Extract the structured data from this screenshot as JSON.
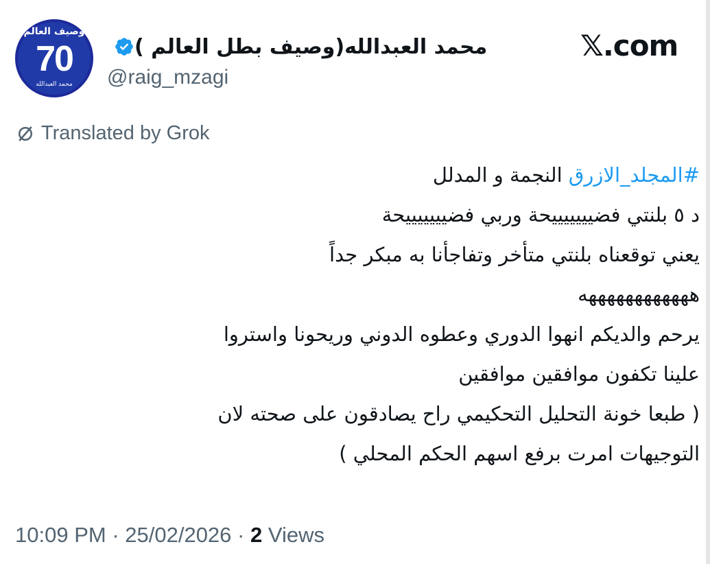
{
  "header": {
    "brand": "𝕏.com",
    "display_name": "محمد العبدالله(وصيف بطل العالم )",
    "handle": "@raig_mzagi",
    "avatar": {
      "top_text": "وصيف العالم",
      "number": "70",
      "bottom_text": "محمد العبدالله"
    }
  },
  "translation_notice": "Translated by Grok",
  "tweet": {
    "hashtag": "#المجلد_الازرق",
    "line1_rest": " النجمة و المدلل",
    "lines": [
      "د ٥ بلنتي فضيييييييحة وربي فضيييييييحة",
      "يعني توقعناه بلنتي متأخر وتفاجأنا به مبكر جداً",
      "ههههههههههههه",
      "يرحم والديكم انهوا الدوري وعطوه الدوني وريحونا واستروا",
      "علينا تكفون موافقين موافقين",
      "( طبعا خونة التحليل التحكيمي راح يصادقون على صحته لان",
      "التوجيهات امرت برفع اسهم الحكم المحلي )"
    ]
  },
  "meta": {
    "time": "10:09 PM",
    "separator": " · ",
    "date": "25/02/2026",
    "views_count": "2",
    "views_label": "Views"
  },
  "colors": {
    "text": "#0f1419",
    "secondary": "#536471",
    "link": "#1d9bf0",
    "verified": "#1d9bf0",
    "avatar_bg": "#1d2a9a"
  }
}
